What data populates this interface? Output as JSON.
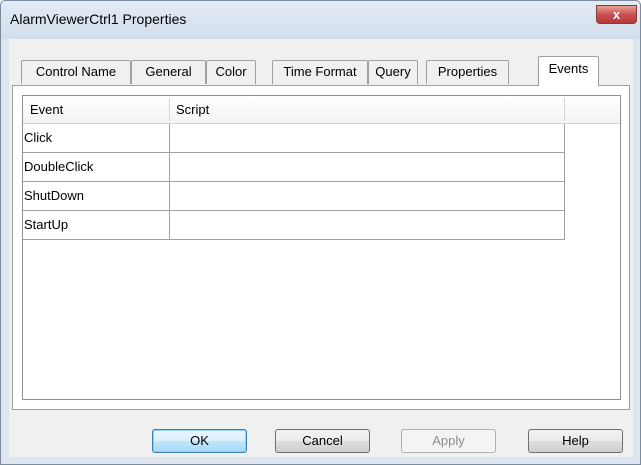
{
  "window": {
    "title": "AlarmViewerCtrl1 Properties",
    "close_label": "x"
  },
  "tabs": [
    {
      "label": "Control Name",
      "active": false
    },
    {
      "label": "General",
      "active": false
    },
    {
      "label": "Color",
      "active": false
    },
    {
      "label": "Time Format",
      "active": false
    },
    {
      "label": "Query",
      "active": false
    },
    {
      "label": "Properties",
      "active": false
    },
    {
      "label": "Events",
      "active": true
    }
  ],
  "grid": {
    "columns": [
      "Event",
      "Script"
    ],
    "rows": [
      {
        "event": "Click",
        "script": ""
      },
      {
        "event": "DoubleClick",
        "script": ""
      },
      {
        "event": "ShutDown",
        "script": ""
      },
      {
        "event": "StartUp",
        "script": ""
      }
    ]
  },
  "buttons": {
    "ok": "OK",
    "cancel": "Cancel",
    "apply": "Apply",
    "help": "Help"
  },
  "colors": {
    "title_bar": "#dde5ee",
    "close_button": "#c75050",
    "default_button_border": "#3c7fb1"
  }
}
